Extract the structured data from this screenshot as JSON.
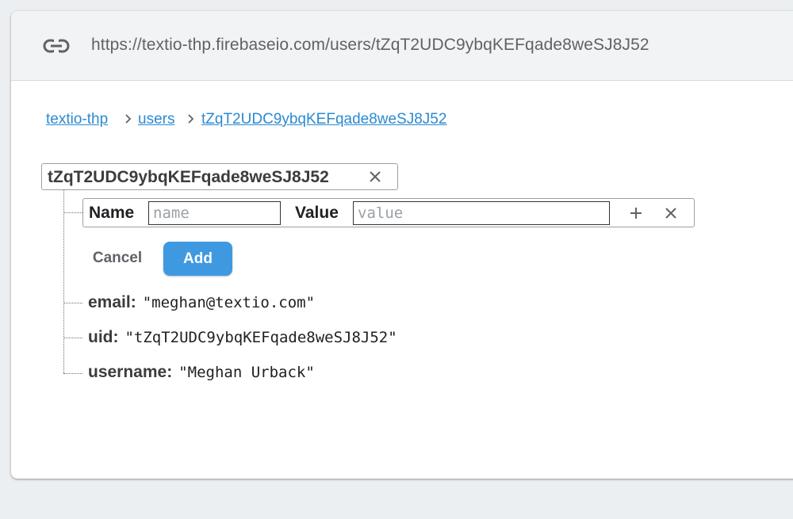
{
  "url": "https://textio-thp.firebaseio.com/users/tZqT2UDC9ybqKEFqade8weSJ8J52",
  "breadcrumb": [
    "textio-thp",
    "users",
    "tZqT2UDC9ybqKEFqade8weSJ8J52"
  ],
  "node": {
    "key": "tZqT2UDC9ybqKEFqade8weSJ8J52",
    "add_child": {
      "name_label": "Name",
      "name_value": "",
      "name_placeholder": "name",
      "value_label": "Value",
      "value_value": "",
      "value_placeholder": "value"
    },
    "cancel_label": "Cancel",
    "add_label": "Add",
    "children": [
      {
        "key": "email:",
        "value": "\"meghan@textio.com\""
      },
      {
        "key": "uid:",
        "value": "\"tZqT2UDC9ybqKEFqade8weSJ8J52\""
      },
      {
        "key": "username:",
        "value": "\"Meghan Urback\""
      }
    ]
  },
  "colors": {
    "link": "#2b8ad2",
    "primary_button": "#3f99e0",
    "page_background": "#eceff1",
    "url_bar": "#f2f3f4"
  },
  "icons": [
    "link-icon",
    "chevron-right-icon",
    "close-icon",
    "plus-icon"
  ]
}
